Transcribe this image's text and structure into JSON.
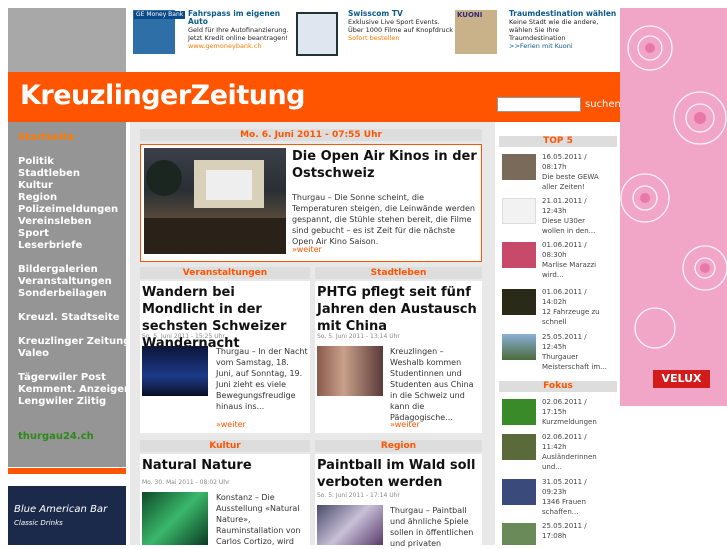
{
  "ads": {
    "ad1": {
      "title": "Fahrspass im eigenen Auto",
      "line1": "Geld für Ihre Autofinanzierung.",
      "line2": "Jetzt Kredit online beantragen!",
      "link": "www.gemoneybank.ch",
      "brand": "GE Money Bank"
    },
    "ad2": {
      "title": "Swisscom TV",
      "line1": "Exklusive Live Sport Events.",
      "line2": "Über 1000 Filme auf Knopfdruck",
      "link": "Sofort bestellen"
    },
    "ad3": {
      "title": "Traumdestination wählen",
      "line1": "Keine Stadt wie die andere,",
      "line2": "wählen Sie Ihre",
      "line3": "Traumdestination",
      "link": ">>Ferien mit Kuoni",
      "brand": "KUONI"
    },
    "velux": "VELUX"
  },
  "header": {
    "logo": "KreuzlingerZeitung",
    "search_button": "suchen",
    "search_placeholder": ""
  },
  "sidebar": {
    "items": [
      "Startseite",
      "Politik",
      "Stadtleben",
      "Kultur",
      "Region",
      "Polizeimeldungen",
      "Vereinsleben",
      "Sport",
      "Leserbriefe",
      "Bildergalerien",
      "Veranstaltungen",
      "Sonderbeilagen",
      "Kreuzl. Stadtseite",
      "Kreuzlinger Zeitung",
      "Valeo",
      "Tägerwiler Post",
      "Kemment. Anzeiger",
      "Lengwiler Ziitig",
      "thurgau24.ch"
    ],
    "ad": "Blue American Bar",
    "ad_sub": "Classic Drinks"
  },
  "main": {
    "date": "Mo. 6. Juni 2011 - 07:55 Uhr",
    "feature": {
      "title": "Die Open Air Kinos in der Ostschweiz",
      "body": "Thurgau – Die Sonne scheint, die Temperaturen steigen, die Leinwände werden gespannt, die Stühle stehen bereit, die Filme sind gebucht – es ist Zeit für die nächste Open Air Kino Saison.",
      "more": "»weiter"
    },
    "sections": [
      {
        "label": "Veranstaltungen",
        "title": "Wandern bei Mondlicht in der sechsten Schweizer Wandernacht",
        "meta": "So. 5. Juni 2011 - 15:25 Uhr",
        "body": "Thurgau – In der Nacht vom Samstag, 18. Juni, auf Sonntag, 19. Juni zieht es viele Bewegungsfreudige hinaus ins...",
        "more": "»weiter"
      },
      {
        "label": "Stadtleben",
        "title": "PHTG pflegt seit fünf Jahren den Austausch mit China",
        "meta": "So. 5. Juni 2011 - 13:14 Uhr",
        "body": "Kreuzlingen – Weshalb kommen Studentinnen und Studenten aus China in die Schweiz und kann die Pädagogische...",
        "more": "»weiter"
      },
      {
        "label": "Kultur",
        "title": "Natural Nature",
        "meta": "Mo. 30. Mai 2011 - 08:02 Uhr",
        "body": "Konstanz – Die Ausstellung «Natural Nature», Rauminstallation von Carlos Cortizo, wird",
        "more": ""
      },
      {
        "label": "Region",
        "title": "Paintball im Wald soll verboten werden",
        "meta": "So. 5. Juni 2011 - 17:14 Uhr",
        "body": "Thurgau – Paintball und ähnliche Spiele sollen in öffentlichen und privaten",
        "more": ""
      }
    ]
  },
  "right": {
    "top5_label": "TOP 5",
    "top5": [
      {
        "date": "16.05.2011 /",
        "time": "08:17h",
        "text1": "Die beste GEWA",
        "text2": "aller Zeiten!"
      },
      {
        "date": "21.01.2011 /",
        "time": "12:43h",
        "text1": "Diese U30er",
        "text2": "wollen in den..."
      },
      {
        "date": "01.06.2011 /",
        "time": "08:30h",
        "text1": "Marlise Marazzi",
        "text2": "wird..."
      },
      {
        "date": "01.06.2011 /",
        "time": "14:02h",
        "text1": "12 Fahrzeuge zu",
        "text2": "schnell"
      },
      {
        "date": "25.05.2011 /",
        "time": "12:45h",
        "text1": "Thurgauer",
        "text2": "Meisterschaft im..."
      }
    ],
    "fokus_label": "Fokus",
    "fokus": [
      {
        "date": "02.06.2011 /",
        "time": "17:15h",
        "text1": "Kurzmeldungen",
        "text2": ""
      },
      {
        "date": "02.06.2011 /",
        "time": "11:42h",
        "text1": "Ausländerinnen",
        "text2": "und..."
      },
      {
        "date": "31.05.2011 /",
        "time": "09:23h",
        "text1": "1346 Frauen",
        "text2": "schaffen..."
      },
      {
        "date": "25.05.2011 /",
        "time": "17:08h",
        "text1": "",
        "text2": ""
      }
    ]
  }
}
